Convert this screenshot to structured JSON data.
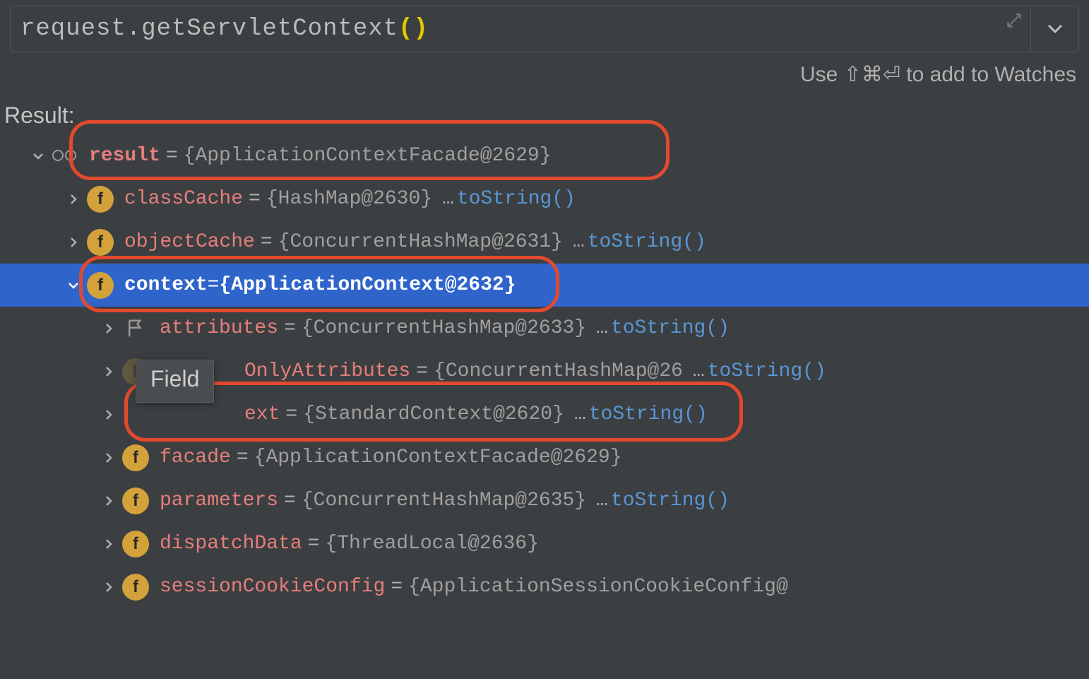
{
  "expression": {
    "text": "request.getServletContext",
    "parens": "()"
  },
  "hint": "Use ⇧⌘⏎ to add to Watches",
  "result_label": "Result:",
  "tooltip": "Field",
  "rows": [
    {
      "name": "result",
      "eq": " = ",
      "value": "{ApplicationContextFacade@2629}",
      "tostring": null
    },
    {
      "name": "classCache",
      "eq": " = ",
      "value": "{HashMap@2630}",
      "tostring": "toString()"
    },
    {
      "name": "objectCache",
      "eq": " = ",
      "value": "{ConcurrentHashMap@2631}",
      "tostring": "toString()"
    },
    {
      "name": "context",
      "eq": " = ",
      "value": "{ApplicationContext@2632}",
      "tostring": null
    },
    {
      "name": "attributes",
      "eq": " = ",
      "value": "{ConcurrentHashMap@2633}",
      "tostring": "toString()"
    },
    {
      "name": "OnlyAttributes",
      "eq": " = ",
      "value": "{ConcurrentHashMap@26",
      "ellipsis": "…",
      "tostring": "toString()"
    },
    {
      "name": "ext",
      "eq": " = ",
      "value": "{StandardContext@2620}",
      "tostring": "toString()"
    },
    {
      "name": "facade",
      "eq": " = ",
      "value": "{ApplicationContextFacade@2629}",
      "tostring": null
    },
    {
      "name": "parameters",
      "eq": " = ",
      "value": "{ConcurrentHashMap@2635}",
      "tostring": "toString()"
    },
    {
      "name": "dispatchData",
      "eq": " = ",
      "value": "{ThreadLocal@2636}",
      "tostring": null
    },
    {
      "name": "sessionCookieConfig",
      "eq": " = ",
      "value": "{ApplicationSessionCookieConfig@",
      "tostring": null
    }
  ]
}
